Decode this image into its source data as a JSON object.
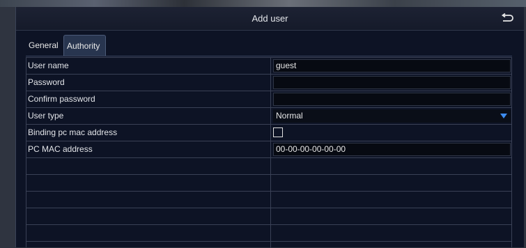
{
  "dialog": {
    "title": "Add user"
  },
  "tabs": [
    {
      "label": "General"
    },
    {
      "label": "Authority"
    }
  ],
  "form": {
    "user_name": {
      "label": "User name",
      "value": "guest"
    },
    "password": {
      "label": "Password",
      "value": ""
    },
    "confirm_password": {
      "label": "Confirm password",
      "value": ""
    },
    "user_type": {
      "label": "User type",
      "value": "Normal"
    },
    "binding_mac": {
      "label": "Binding pc mac address",
      "checked": false
    },
    "pc_mac": {
      "label": "PC MAC address",
      "value": "00-00-00-00-00-00"
    }
  },
  "colors": {
    "accent": "#3d8cf0",
    "dialog_bg": "#0d1325",
    "active_tab": "#28354f"
  },
  "icons": {
    "back": "return-arrow-icon",
    "dropdown": "triangle-down-icon"
  }
}
